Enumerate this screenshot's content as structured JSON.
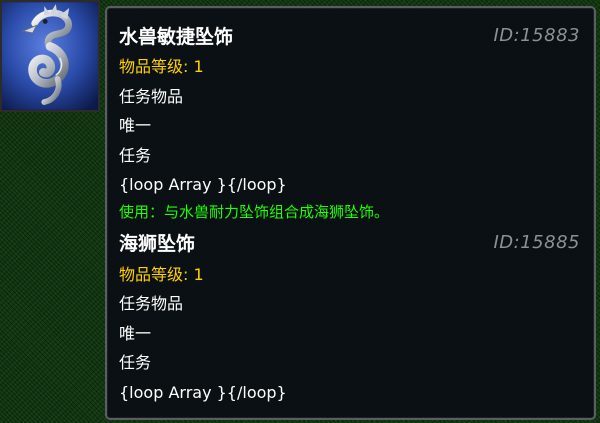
{
  "item_icon": {
    "icon": "seahorse-pendant-icon",
    "background_color": "#2a4aa8"
  },
  "items": [
    {
      "name": "水兽敏捷坠饰",
      "id": "ID:15883",
      "level": "物品等级: 1",
      "type": "任务物品",
      "unique": "唯一",
      "quest": "任务",
      "template": "{loop Array }{/loop}",
      "use": "使用：与水兽耐力坠饰组合成海狮坠饰。"
    },
    {
      "name": "海狮坠饰",
      "id": "ID:15885",
      "level": "物品等级: 1",
      "type": "任务物品",
      "unique": "唯一",
      "quest": "任务",
      "template": "{loop Array }{/loop}"
    }
  ],
  "colors": {
    "name": "#ffffff",
    "id": "#8d9196",
    "level": "#ffd100",
    "use": "#1eff00",
    "tooltip_bg": "#0a0e14",
    "tooltip_border": "#5a5d63"
  }
}
